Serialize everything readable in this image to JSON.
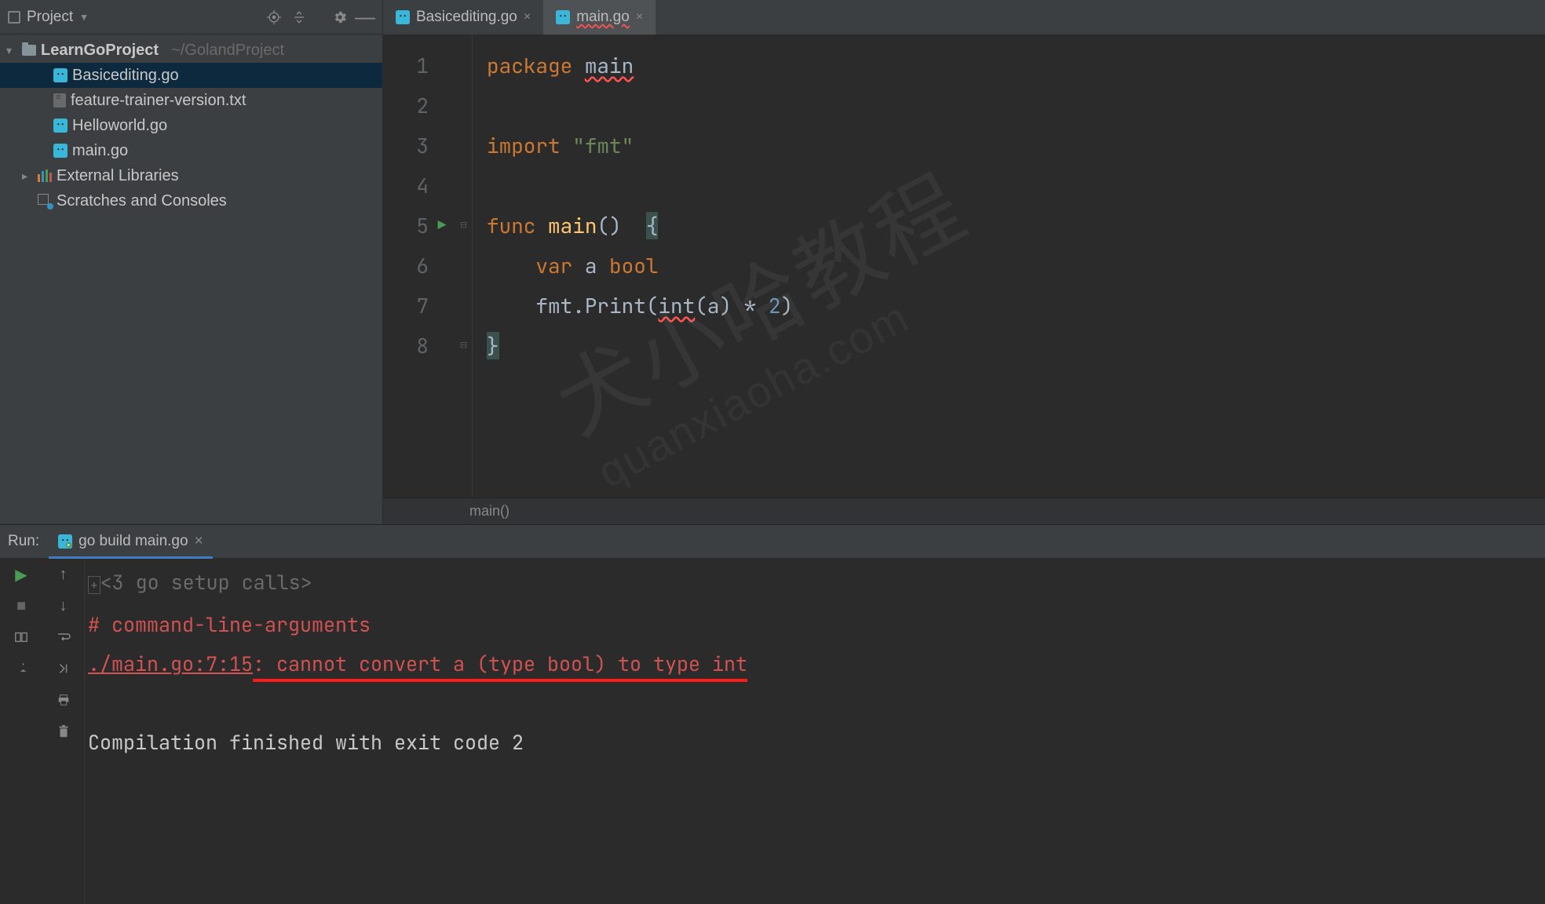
{
  "sidebar": {
    "title": "Project",
    "root": {
      "name": "LearnGoProject",
      "hint": "~/GolandProject"
    },
    "files": [
      {
        "name": "Basicediting.go",
        "icon": "go",
        "selected": true
      },
      {
        "name": "feature-trainer-version.txt",
        "icon": "txt",
        "selected": false
      },
      {
        "name": "Helloworld.go",
        "icon": "go",
        "selected": false
      },
      {
        "name": "main.go",
        "icon": "go",
        "selected": false
      }
    ],
    "external": "External Libraries",
    "scratches": "Scratches and Consoles"
  },
  "tabs": [
    {
      "label": "Basicediting.go",
      "active": false
    },
    {
      "label": "main.go",
      "active": true
    }
  ],
  "code": {
    "lines": [
      "1",
      "2",
      "3",
      "4",
      "5",
      "6",
      "7",
      "8"
    ],
    "tokens": {
      "package_kw": "package",
      "package_name": "main",
      "import_kw": "import",
      "import_val": "\"fmt\"",
      "func_kw": "func",
      "func_name": "main",
      "paren": "()",
      "brace_open": "{",
      "var_kw": "var",
      "var_name": "a",
      "var_type": "bool",
      "call_pkg": "fmt",
      "call_fn": ".Print(",
      "cast": "int",
      "cast_arg": "(a)",
      "op": " * ",
      "num": "2",
      "close_paren": ")",
      "brace_close": "}"
    }
  },
  "breadcrumb": "main()",
  "run": {
    "panel_label": "Run:",
    "tab": "go build main.go",
    "console": {
      "setup": "<3 go setup calls>",
      "hdr": "# command-line-arguments",
      "link": "./main.go:7:15",
      "msg": ": cannot convert a (type bool) to type int",
      "footer": "Compilation finished with exit code 2"
    }
  },
  "watermark": {
    "line1": "犬小哈教程",
    "line2": "quanxiaoha.com"
  }
}
